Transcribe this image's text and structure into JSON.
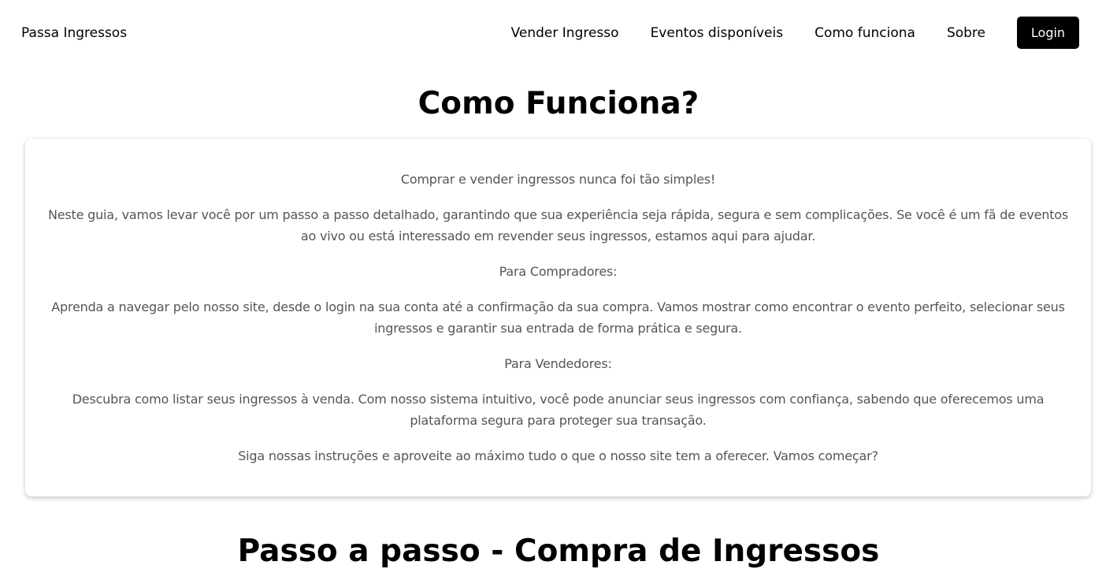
{
  "header": {
    "brand": "Passa Ingressos",
    "nav": {
      "sell": "Vender Ingresso",
      "events": "Eventos disponíveis",
      "how": "Como funciona",
      "about": "Sobre",
      "login": "Login"
    }
  },
  "main": {
    "title": "Como Funciona?",
    "intro": {
      "p1": "Comprar e vender ingressos nunca foi tão simples!",
      "p2": "Neste guia, vamos levar você por um passo a passo detalhado, garantindo que sua experiência seja rápida, segura e sem complicações. Se você é um fã de eventos ao vivo ou está interessado em revender seus ingressos, estamos aqui para ajudar.",
      "p3": "Para Compradores:",
      "p4": "Aprenda a navegar pelo nosso site, desde o login na sua conta até a confirmação da sua compra. Vamos mostrar como encontrar o evento perfeito, selecionar seus ingressos e garantir sua entrada de forma prática e segura.",
      "p5": "Para Vendedores:",
      "p6": "Descubra como listar seus ingressos à venda. Com nosso sistema intuitivo, você pode anunciar seus ingressos com confiança, sabendo que oferecemos uma plataforma segura para proteger sua transação.",
      "p7": "Siga nossas instruções e aproveite ao máximo tudo o que o nosso site tem a oferecer. Vamos começar?"
    },
    "section_title": "Passo a passo - Compra de Ingressos"
  },
  "colors": {
    "button_bg": "#000000",
    "button_text": "#ffffff",
    "body_text": "#555555"
  }
}
